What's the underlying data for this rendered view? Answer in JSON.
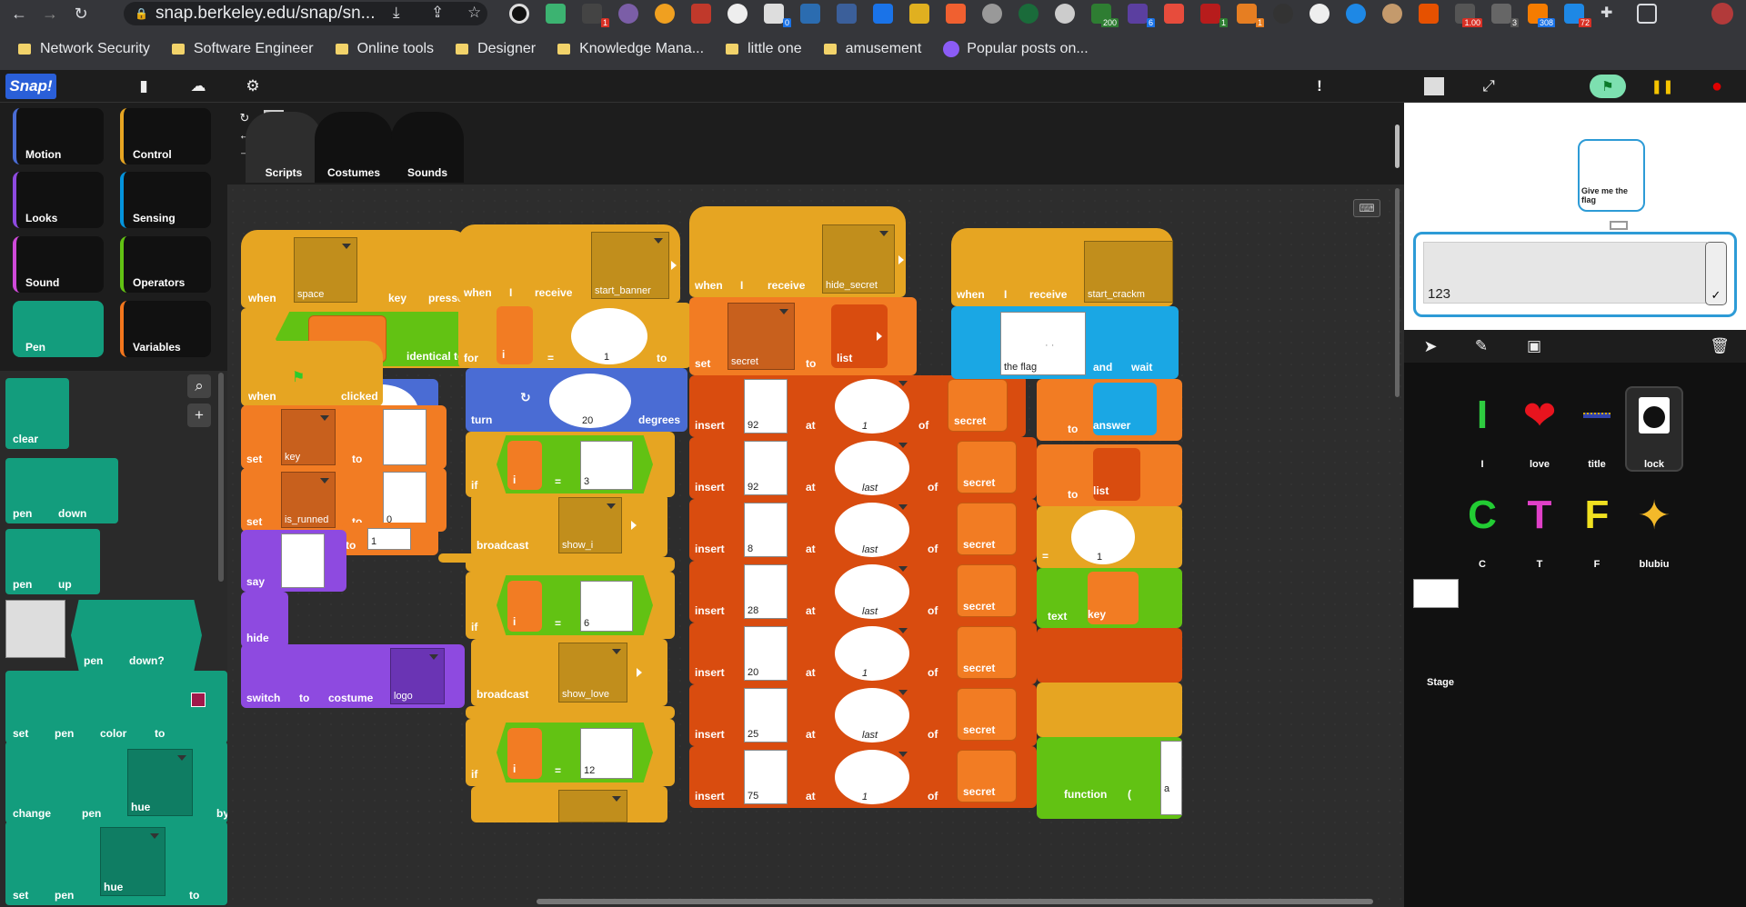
{
  "browser": {
    "url": "snap.berkeley.edu/snap/sn...",
    "bookmarks": [
      "Network Security",
      "Software Engineer",
      "Online tools",
      "Designer",
      "Knowledge Mana...",
      "little one",
      "amusement",
      "Popular posts on..."
    ],
    "ext_badges": [
      "1",
      "0",
      "200",
      "6",
      "1",
      "1",
      "1.00",
      "3",
      "308",
      "72"
    ]
  },
  "snap": {
    "logo": "Snap!",
    "categories": [
      "Motion",
      "Control",
      "Looks",
      "Sensing",
      "Sound",
      "Operators",
      "Pen",
      "Variables"
    ],
    "palette": {
      "clear": "clear",
      "pen_down": [
        "pen",
        "down"
      ],
      "pen_up": [
        "pen",
        "up"
      ],
      "pen_down_q": [
        "pen",
        "down?"
      ],
      "set_pen_color": [
        "set",
        "pen",
        "color",
        "to"
      ],
      "change_pen": [
        "change",
        "pen",
        "hue",
        "by"
      ],
      "set_pen_hue": [
        "set",
        "pen",
        "hue",
        "to"
      ]
    },
    "tabs": [
      "Scripts",
      "Costumes",
      "Sounds"
    ],
    "scripts": {
      "s1": {
        "when": "when",
        "key_val": "space",
        "key": "key",
        "pressed": "pressed",
        "if": "if",
        "is": "is",
        "is_runned": "is_runned",
        "identical_to": "identical to",
        "zero": "0",
        "zero2": "0",
        "when2": "when",
        "clicked": "clicked",
        "set": "set",
        "key_var": "key",
        "to": "to",
        "set2": "set",
        "is_runned_var": "is_runned",
        "to2": "to",
        "zero3": "0",
        "to3": "to",
        "one": "1",
        "say": "say",
        "hide": "hide",
        "switch": "switch",
        "to4": "to",
        "costume": "costume",
        "logo": "logo"
      },
      "s2": {
        "when": "when",
        "i": "I",
        "receive": "receive",
        "msg": "start_banner",
        "for": "for",
        "ivar": "i",
        "eq": "=",
        "one": "1",
        "to": "to",
        "turn": "turn",
        "twenty": "20",
        "degrees": "degrees",
        "if1": "if",
        "i1": "i",
        "eq1": "=",
        "n1": "3",
        "broadcast1": "broadcast",
        "msg1": "show_i",
        "if2": "if",
        "i2": "i",
        "eq2": "=",
        "n2": "6",
        "broadcast2": "broadcast",
        "msg2": "show_love",
        "if3": "if",
        "i3": "i",
        "eq3": "=",
        "n3": "12"
      },
      "s3": {
        "when": "when",
        "i": "I",
        "receive": "receive",
        "msg": "hide_secret",
        "set": "set",
        "var": "secret",
        "to": "to",
        "list": "list",
        "inserts": [
          {
            "item": "92",
            "at": "at",
            "pos": "1",
            "of": "of",
            "list": "secret"
          },
          {
            "item": "92",
            "at": "at",
            "pos": "last",
            "of": "of",
            "list": "secret"
          },
          {
            "item": "8",
            "at": "at",
            "pos": "last",
            "of": "of",
            "list": "secret"
          },
          {
            "item": "28",
            "at": "at",
            "pos": "last",
            "of": "of",
            "list": "secret"
          },
          {
            "item": "20",
            "at": "at",
            "pos": "1",
            "of": "of",
            "list": "secret"
          },
          {
            "item": "25",
            "at": "at",
            "pos": "last",
            "of": "of",
            "list": "secret"
          },
          {
            "item": "75",
            "at": "at",
            "pos": "1",
            "of": "of",
            "list": "secret"
          }
        ],
        "insert": "insert"
      },
      "s4": {
        "when": "when",
        "i": "I",
        "receive": "receive",
        "msg": "start_crackm",
        "ask_text": "the flag",
        "and": "and",
        "wait": "wait",
        "to1": "to",
        "answer": "answer",
        "to2": "to",
        "list": "list",
        "eq": "=",
        "one": "1",
        "text": "text",
        "key": "key",
        "function": "function",
        "paren": "(",
        "a": "a"
      }
    },
    "stage": {
      "bubble": "Give me the flag",
      "answer": "123"
    },
    "sprites": [
      {
        "name": "I",
        "glyph": "I",
        "color": "#2ecc40"
      },
      {
        "name": "love",
        "glyph": "❤",
        "color": "#e8141e"
      },
      {
        "name": "title",
        "glyph": "",
        "color": "#3344aa"
      },
      {
        "name": "lock",
        "glyph": "",
        "color": "#ffffff"
      },
      {
        "name": "C",
        "glyph": "C",
        "color": "#22cc33"
      },
      {
        "name": "T",
        "glyph": "T",
        "color": "#e040c8"
      },
      {
        "name": "F",
        "glyph": "F",
        "color": "#f0e020"
      },
      {
        "name": "blubiu",
        "glyph": "✦",
        "color": "#f3b92a"
      }
    ],
    "stage_label": "Stage"
  }
}
